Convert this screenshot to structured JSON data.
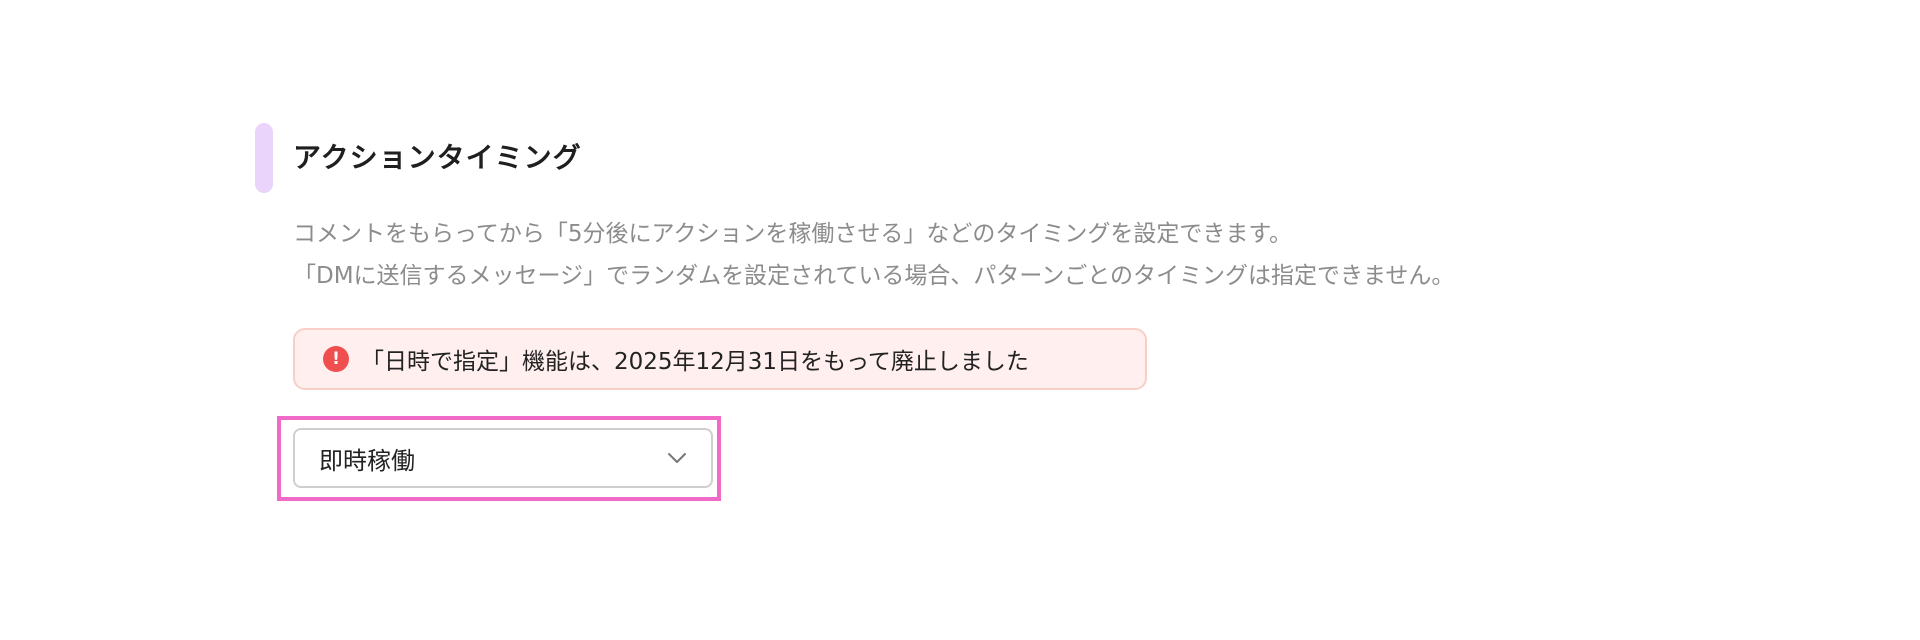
{
  "section": {
    "title": "アクションタイミング",
    "description_lines": [
      "コメントをもらってから「5分後にアクションを稼働させる」などのタイミングを設定できます。",
      "「DMに送信するメッセージ」でランダムを設定されている場合、パターンごとのタイミングは指定できません。"
    ]
  },
  "alert": {
    "icon": "exclamation-icon",
    "icon_glyph": "!",
    "text": "「日時で指定」機能は、2025年12月31日をもって廃止しました"
  },
  "timing_select": {
    "selected_value": "即時稼働",
    "icon": "chevron-down-icon"
  },
  "colors": {
    "accent_bar": "#ead4fb",
    "alert_background": "#fff0ef",
    "alert_border": "#f8cfc8",
    "alert_icon": "#f04f4f",
    "highlight_border": "#f26ac8"
  }
}
